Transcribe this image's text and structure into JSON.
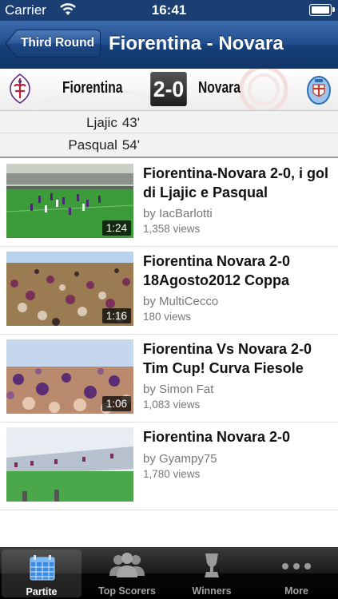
{
  "status_bar": {
    "carrier": "Carrier",
    "time": "16:41"
  },
  "nav": {
    "back_label": "Third Round",
    "title": "Fiorentina - Novara"
  },
  "match": {
    "home_team": "Fiorentina",
    "away_team": "Novara",
    "score": "2-0",
    "home_logo_icon": "fiorentina-crest-icon",
    "away_logo_icon": "novara-crest-icon",
    "scorers": [
      {
        "name": "Ljajic",
        "minute": "43'"
      },
      {
        "name": "Pasqual",
        "minute": "54'"
      }
    ]
  },
  "videos": [
    {
      "title": "Fiorentina-Novara 2-0, i gol di Ljajic e Pasqual",
      "author": "by IacBarlotti",
      "views": "1,358 views",
      "duration": "1:24"
    },
    {
      "title": "Fiorentina Novara 2-0 18Agosto2012 Coppa",
      "author": "by MultiCecco",
      "views": "180 views",
      "duration": "1:16"
    },
    {
      "title": "Fiorentina Vs Novara 2-0 Tim Cup! Curva Fiesole",
      "author": "by Simon Fat",
      "views": "1,083 views",
      "duration": "1:06"
    },
    {
      "title": "Fiorentina Novara 2-0",
      "author": "by Gyampy75",
      "views": "1,780 views",
      "duration": ""
    }
  ],
  "tabs": [
    {
      "label": "Partite",
      "icon": "calendar-icon",
      "selected": true
    },
    {
      "label": "Top Scorers",
      "icon": "people-icon",
      "selected": false
    },
    {
      "label": "Winners",
      "icon": "trophy-icon",
      "selected": false
    },
    {
      "label": "More",
      "icon": "more-dots-icon",
      "selected": false
    }
  ],
  "colors": {
    "nav_blue": "#1f4d8c",
    "calendar_blue": "#3d8be0",
    "fiorentina_purple": "#5a2d82",
    "novara_blue": "#2f6fb5"
  }
}
